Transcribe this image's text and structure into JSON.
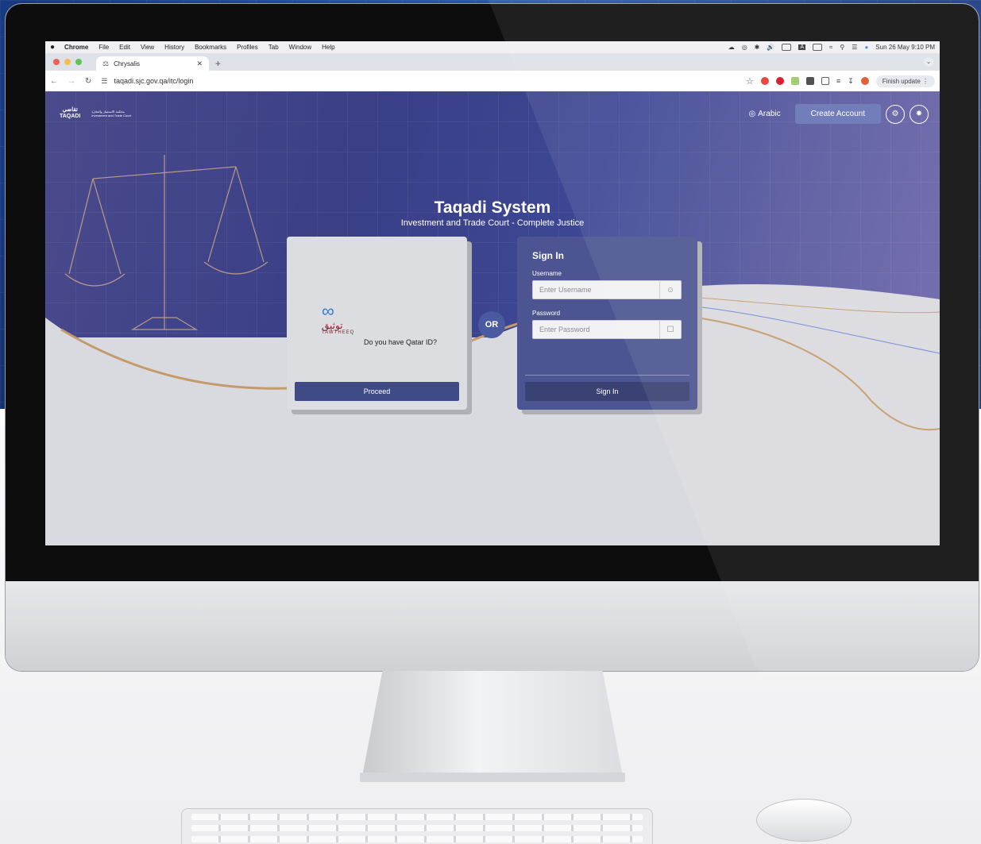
{
  "menubar": {
    "items": [
      "Chrome",
      "File",
      "Edit",
      "View",
      "History",
      "Bookmarks",
      "Profiles",
      "Tab",
      "Window",
      "Help"
    ],
    "datetime": "Sun 26 May  9:10 PM"
  },
  "browser": {
    "tab_title": "Chrysalis",
    "url": "taqadi.sjc.gov.qa/itc/login",
    "finish_update": "Finish update"
  },
  "header": {
    "taqadi_logo_ar": "تقاضي",
    "taqadi_logo_en": "TAQADI",
    "court_logo_ar": "محكمة الاستثمار والتجارة",
    "court_logo_en": "Investment and Trade Court",
    "language_label": "Arabic",
    "create_account_label": "Create Account"
  },
  "hero": {
    "title": "Taqadi System",
    "subtitle": "Investment and Trade Court - Complete Justice"
  },
  "qatar_id_card": {
    "logo_ar": "توثيق",
    "logo_en": "TAWTHEEQ",
    "question": "Do you have Qatar ID?",
    "proceed_label": "Proceed"
  },
  "or_label": "OR",
  "signin_card": {
    "title": "Sign In",
    "username_label": "Username",
    "username_placeholder": "Enter Username",
    "password_label": "Password",
    "password_placeholder": "Enter Password",
    "submit_label": "Sign In"
  },
  "colors": {
    "hero_purple": "#3d4794",
    "button_navy": "#3e4b86",
    "signin_card": "#4c5592",
    "create_account": "#6673b3",
    "wave_gold": "#c59a6a"
  }
}
